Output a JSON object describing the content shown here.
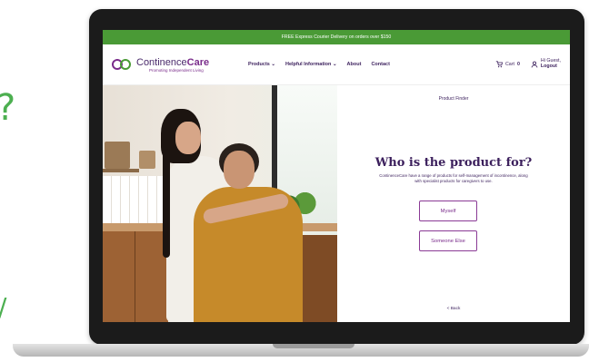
{
  "decorations": {
    "question_mark": "?",
    "slash": "/"
  },
  "promo_bar": {
    "text": "FREE Express Courier Delivery on orders over $150"
  },
  "header": {
    "logo": {
      "name_part1": "Continence",
      "name_part2": "Care",
      "tagline": "Promoting Independent Living"
    },
    "menu": [
      {
        "label": "Products",
        "has_dropdown": true
      },
      {
        "label": "Helpful Information",
        "has_dropdown": true
      },
      {
        "label": "About",
        "has_dropdown": false
      },
      {
        "label": "Contact",
        "has_dropdown": false
      }
    ],
    "cart": {
      "label": "Cart",
      "count": "0"
    },
    "account": {
      "greeting": "Hi Guest,",
      "action": "Logout"
    }
  },
  "finder": {
    "label": "Product Finder",
    "question": "Who is the product for?",
    "description": "ContinenceCare have a range of products for self-management of incontinence, along with specialist products for caregivers to use.",
    "options": [
      "Myself",
      "Someone Else"
    ],
    "back_label": "< Back"
  },
  "icons": {
    "cart": "cart-icon",
    "account": "user-icon",
    "chevron": "chevron-down-icon"
  },
  "colors": {
    "promo_green": "#4a9a36",
    "brand_purple": "#7a2c8b",
    "text_navy": "#3b1f5c"
  }
}
